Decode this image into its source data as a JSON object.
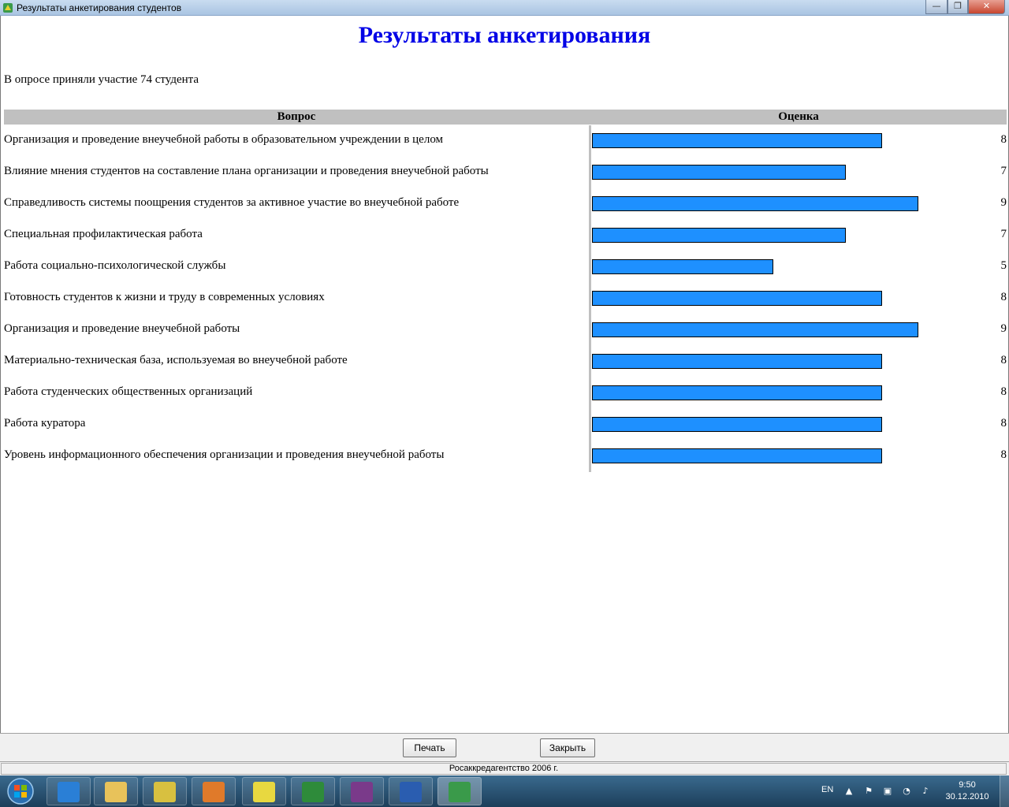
{
  "window": {
    "title": "Результаты анкетирования студентов",
    "minimize_glyph": "—",
    "maximize_glyph": "❐",
    "close_glyph": "✕"
  },
  "report": {
    "title": "Результаты анкетирования",
    "participants_text": "В опросе приняли участие 74 студента",
    "col_question": "Вопрос",
    "col_score": "Оценка",
    "max_score": 10,
    "bar_color": "#1e90ff",
    "rows": [
      {
        "question": "Организация и проведение внеучебной работы в образовательном учреждении в целом",
        "score": 8
      },
      {
        "question": "Влияние мнения студентов на составление плана организации и проведения внеучебной работы",
        "score": 7
      },
      {
        "question": "Справедливость системы поощрения студентов за активное участие во внеучебной работе",
        "score": 9
      },
      {
        "question": "Специальная профилактическая работа",
        "score": 7
      },
      {
        "question": "Работа социально-психологической службы",
        "score": 5
      },
      {
        "question": "Готовность студентов к жизни и труду в современных условиях",
        "score": 8
      },
      {
        "question": "Организация и проведение внеучебной работы",
        "score": 9
      },
      {
        "question": "Материально-техническая база, используемая во внеучебной работе",
        "score": 8
      },
      {
        "question": "Работа студенческих общественных организаций",
        "score": 8
      },
      {
        "question": "Работа куратора",
        "score": 8
      },
      {
        "question": "Уровень информационного обеспечения организации и проведения внеучебной работы",
        "score": 8
      }
    ]
  },
  "buttons": {
    "print_label": "Печать",
    "close_label": "Закрыть"
  },
  "status": {
    "text": "Росаккредагентство 2006 г."
  },
  "taskbar": {
    "language": "EN",
    "time": "9:50",
    "date": "30.12.2010",
    "items": [
      {
        "icon": "internet-explorer-icon",
        "color": "#2a7fd6"
      },
      {
        "icon": "file-explorer-icon",
        "color": "#e8c25a"
      },
      {
        "icon": "organizer-app-icon",
        "color": "#d8c040"
      },
      {
        "icon": "media-player-icon",
        "color": "#e07a2a"
      },
      {
        "icon": "bat-antivirus-icon",
        "color": "#e8d840"
      },
      {
        "icon": "excel-icon",
        "color": "#2e8b3a"
      },
      {
        "icon": "winrar-icon",
        "color": "#7a3a8a"
      },
      {
        "icon": "word-icon",
        "color": "#2a5db0"
      },
      {
        "icon": "survey-app-icon",
        "color": "#3a9a4a"
      }
    ],
    "tray_glyphs": [
      "▲",
      "⚑",
      "▣",
      "◔",
      "♪"
    ]
  }
}
